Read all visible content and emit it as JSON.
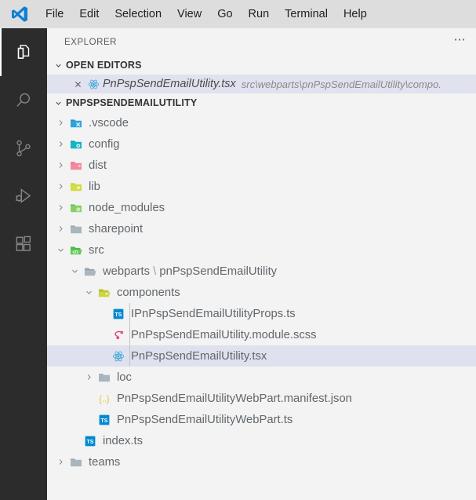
{
  "window": {
    "logo_icon": "vscode-logo"
  },
  "menubar": {
    "items": [
      {
        "label": "File",
        "name": "menu-file"
      },
      {
        "label": "Edit",
        "name": "menu-edit"
      },
      {
        "label": "Selection",
        "name": "menu-selection"
      },
      {
        "label": "View",
        "name": "menu-view"
      },
      {
        "label": "Go",
        "name": "menu-go"
      },
      {
        "label": "Run",
        "name": "menu-run"
      },
      {
        "label": "Terminal",
        "name": "menu-terminal"
      },
      {
        "label": "Help",
        "name": "menu-help"
      }
    ]
  },
  "activitybar": {
    "items": [
      {
        "name": "activitybar-explorer",
        "icon": "files-icon",
        "active": true
      },
      {
        "name": "activitybar-search",
        "icon": "search-icon",
        "active": false
      },
      {
        "name": "activitybar-source-control",
        "icon": "source-control-icon",
        "active": false
      },
      {
        "name": "activitybar-run-debug",
        "icon": "run-and-debug-icon",
        "active": false
      },
      {
        "name": "activitybar-extensions",
        "icon": "extensions-icon",
        "active": false
      }
    ]
  },
  "sidebar": {
    "title": "EXPLORER",
    "more_actions_icon": "ellipsis-icon",
    "open_editors": {
      "header": "OPEN EDITORS",
      "expanded": true,
      "rows": [
        {
          "close_icon": "close-icon",
          "icon": "react-tsx-icon",
          "name": "PnPspSendEmailUtility.tsx",
          "path": "src\\webparts\\pnPspSendEmailUtility\\compo.",
          "selected": true
        }
      ]
    },
    "folder": {
      "header": "PNPSPSENDEMAILUTILITY",
      "expanded": true,
      "rows": [
        {
          "label": ".vscode",
          "icon": "folder-vscode-icon",
          "twisty": "chevron-right",
          "indent": 1,
          "selected": false,
          "guide": false
        },
        {
          "label": "config",
          "icon": "folder-config-icon",
          "twisty": "chevron-right",
          "indent": 1,
          "selected": false,
          "guide": false
        },
        {
          "label": "dist",
          "icon": "folder-dist-icon",
          "twisty": "chevron-right",
          "indent": 1,
          "selected": false,
          "guide": false
        },
        {
          "label": "lib",
          "icon": "folder-lib-icon",
          "twisty": "chevron-right",
          "indent": 1,
          "selected": false,
          "guide": false
        },
        {
          "label": "node_modules",
          "icon": "folder-node-icon",
          "twisty": "chevron-right",
          "indent": 1,
          "selected": false,
          "guide": false
        },
        {
          "label": "sharepoint",
          "icon": "folder-plain-icon",
          "twisty": "chevron-right",
          "indent": 1,
          "selected": false,
          "guide": false
        },
        {
          "label": "src",
          "icon": "folder-src-open-icon",
          "twisty": "chevron-down",
          "indent": 1,
          "selected": false,
          "guide": false
        },
        {
          "label": "webparts \\ pnPspSendEmailUtility",
          "icon": "folder-open-plain-icon",
          "twisty": "chevron-down",
          "indent": 2,
          "selected": false,
          "guide": false
        },
        {
          "label": "components",
          "icon": "folder-components-icon",
          "twisty": "chevron-down",
          "indent": 3,
          "selected": false,
          "guide": false
        },
        {
          "label": "IPnPspSendEmailUtilityProps.ts",
          "icon": "typescript-icon",
          "twisty": "none",
          "indent": 4,
          "selected": false,
          "guide": true
        },
        {
          "label": "PnPspSendEmailUtility.module.scss",
          "icon": "sass-icon",
          "twisty": "none",
          "indent": 4,
          "selected": false,
          "guide": true
        },
        {
          "label": "PnPspSendEmailUtility.tsx",
          "icon": "react-tsx-icon",
          "twisty": "none",
          "indent": 4,
          "selected": true,
          "guide": true
        },
        {
          "label": "loc",
          "icon": "folder-plain-icon",
          "twisty": "chevron-right",
          "indent": 3,
          "selected": false,
          "guide": false
        },
        {
          "label": "PnPspSendEmailUtilityWebPart.manifest.json",
          "icon": "json-icon",
          "twisty": "none",
          "indent": 3,
          "selected": false,
          "guide": false
        },
        {
          "label": "PnPspSendEmailUtilityWebPart.ts",
          "icon": "typescript-icon",
          "twisty": "none",
          "indent": 3,
          "selected": false,
          "guide": false
        },
        {
          "label": "index.ts",
          "icon": "typescript-icon",
          "twisty": "none",
          "indent": 2,
          "selected": false,
          "guide": false
        },
        {
          "label": "teams",
          "icon": "folder-plain-icon",
          "twisty": "chevron-right",
          "indent": 1,
          "selected": false,
          "guide": false
        }
      ]
    }
  },
  "colors": {
    "titlebar_bg": "#dddddd",
    "activitybar_bg": "#2c2c2c",
    "sidebar_bg": "#f3f3f3",
    "selection_bg": "#dfe1ee",
    "text": "#61676c",
    "accent_blue": "#0078d4"
  }
}
